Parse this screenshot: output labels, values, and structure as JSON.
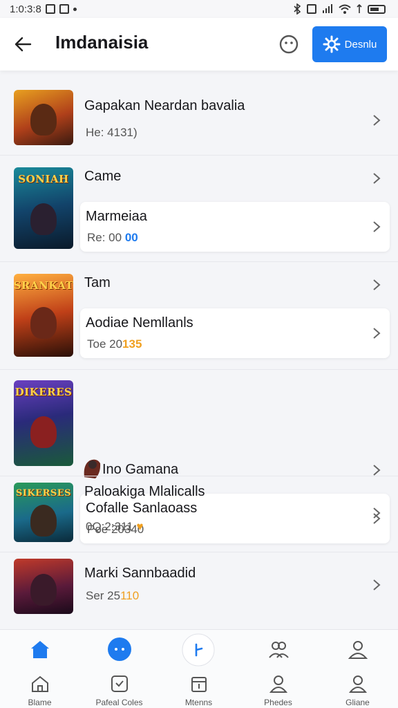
{
  "status_bar": {
    "time": "1:0:3:8"
  },
  "header": {
    "title": "Imdanaisia",
    "action_label": "Desnlu",
    "colors": {
      "accent": "#1e7bef"
    }
  },
  "rows": [
    {
      "title": "Gapakan Neardan bavalia",
      "subtitle": "He: 4131)",
      "thumb_text": ""
    },
    {
      "title": "Came",
      "subtitle": "",
      "thumb_text": "SONIAH",
      "card": {
        "title": "Marmeiaa",
        "subtitle_prefix": "Re: 00",
        "subtitle_highlight": "00"
      }
    },
    {
      "title": "Tam",
      "subtitle": "",
      "thumb_text": "SRANKAT",
      "card": {
        "title": "Aodiae Nemllanls",
        "subtitle_prefix": "Toe 20",
        "subtitle_highlight": "135"
      }
    },
    {
      "title": "Ino Gamana",
      "subtitle": "",
      "thumb_text": "DIKERES",
      "card": {
        "title": "Cofalle Sanlaoass",
        "subtitle": "Poe 20340"
      }
    },
    {
      "title": "Paloakiga Mlalicalls",
      "subtitle": "0Q:2:311",
      "thumb_text": "SIKERSES"
    },
    {
      "title": "Marki Sannbaadid",
      "subtitle_prefix": "Ser 25",
      "subtitle_highlight": "110",
      "thumb_text": ""
    }
  ],
  "bottom_nav": [
    {
      "label": "Blame",
      "top_icon": "home-icon-filled",
      "bottom_icon": "home-icon"
    },
    {
      "label": "Pafeal Coles",
      "top_icon": "chat-bubble-icon",
      "bottom_icon": "check-square-icon"
    },
    {
      "label": "Mtenns",
      "top_icon": "add-circle-icon",
      "bottom_icon": "calendar-icon"
    },
    {
      "label": "Phedes",
      "top_icon": "people-icon",
      "bottom_icon": "person-icon"
    },
    {
      "label": "Gliane",
      "top_icon": "profile-icon",
      "bottom_icon": "profile-icon"
    }
  ],
  "colors": {
    "highlight_blue": "#1e7bef",
    "highlight_orange": "#f0a020"
  }
}
